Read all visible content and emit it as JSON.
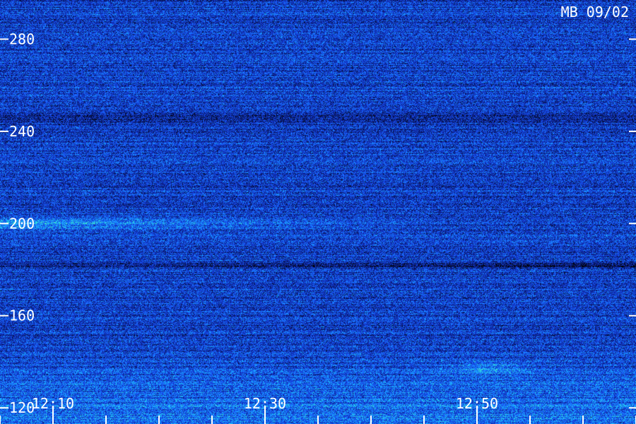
{
  "stamp": "MB 09/02",
  "chart_data": {
    "type": "heatmap",
    "title": "",
    "xlabel": "",
    "ylabel": "",
    "y_ticks": [
      {
        "value": 280,
        "label": "280"
      },
      {
        "value": 240,
        "label": "240"
      },
      {
        "value": 200,
        "label": "200"
      },
      {
        "value": 160,
        "label": "160"
      },
      {
        "value": 120,
        "label": "120"
      }
    ],
    "ylim": [
      113,
      297
    ],
    "x_ticks": [
      {
        "value": "12:10",
        "label": "12:10"
      },
      {
        "value": "12:30",
        "label": "12:30"
      },
      {
        "value": "12:50",
        "label": "12:50"
      }
    ],
    "xlim": [
      "12:05",
      "13:05"
    ],
    "x_minor_tick_interval_minutes": 5,
    "colormap": [
      "#000000",
      "#0a1a6e",
      "#1234c8",
      "#1a66ff",
      "#19b8ff",
      "#4dffb0"
    ],
    "grid": false,
    "legend": "none"
  }
}
